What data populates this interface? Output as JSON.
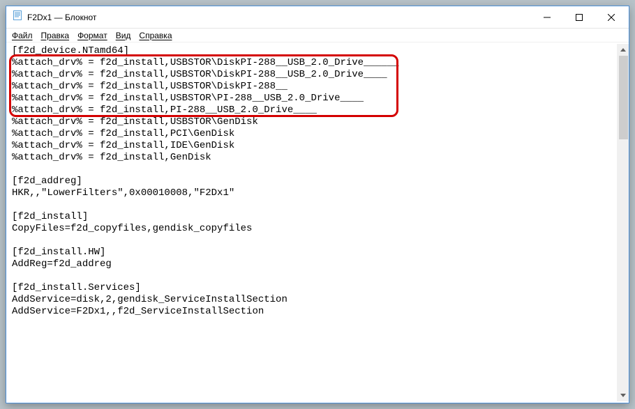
{
  "window": {
    "title": "F2Dx1 — Блокнот"
  },
  "menu": {
    "file": "Файл",
    "edit": "Правка",
    "format": "Формат",
    "view": "Вид",
    "help": "Справка"
  },
  "lines": [
    "[f2d_device.NTamd64]",
    "%attach_drv% = f2d_install,USBSTOR\\DiskPI-288__USB_2.0_Drive______",
    "%attach_drv% = f2d_install,USBSTOR\\DiskPI-288__USB_2.0_Drive____",
    "%attach_drv% = f2d_install,USBSTOR\\DiskPI-288__",
    "%attach_drv% = f2d_install,USBSTOR\\PI-288__USB_2.0_Drive____",
    "%attach_drv% = f2d_install,PI-288__USB_2.0_Drive____",
    "%attach_drv% = f2d_install,USBSTOR\\GenDisk",
    "%attach_drv% = f2d_install,PCI\\GenDisk",
    "%attach_drv% = f2d_install,IDE\\GenDisk",
    "%attach_drv% = f2d_install,GenDisk",
    "",
    "[f2d_addreg]",
    "HKR,,\"LowerFilters\",0x00010008,\"F2Dx1\"",
    "",
    "[f2d_install]",
    "CopyFiles=f2d_copyfiles,gendisk_copyfiles",
    "",
    "[f2d_install.HW]",
    "AddReg=f2d_addreg",
    "",
    "[f2d_install.Services]",
    "AddService=disk,2,gendisk_ServiceInstallSection",
    "AddService=F2Dx1,,f2d_ServiceInstallSection",
    ""
  ]
}
